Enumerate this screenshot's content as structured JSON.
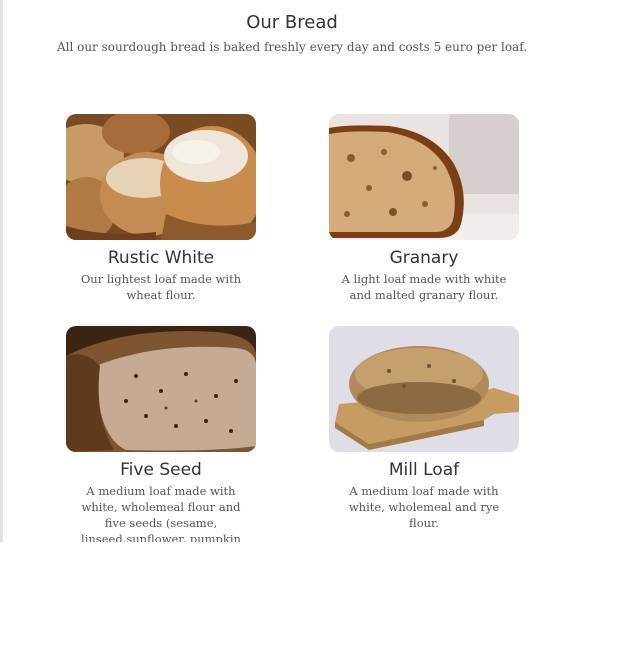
{
  "header": {
    "title": "Our Bread",
    "subtitle": "All our sourdough bread is baked freshly every day and costs 5 euro per loaf."
  },
  "breads": [
    {
      "name": "Rustic White",
      "description": "Our lightest loaf made with wheat flour.",
      "image": "rustic-white-bread-photo"
    },
    {
      "name": "Granary",
      "description": "A light loaf made with white and malted granary flour.",
      "image": "granary-bread-photo"
    },
    {
      "name": "Five Seed",
      "description": "A medium loaf made with white, wholemeal flour and five seeds (sesame, linseed,sunflower, pumpkin and poppy)",
      "image": "five-seed-bread-photo"
    },
    {
      "name": "Mill Loaf",
      "description": "A medium loaf made with white, wholemeal and rye flour.",
      "image": "mill-loaf-bread-photo"
    }
  ],
  "colors": {
    "text": "#333333",
    "muted": "#555555",
    "crust": "#8a5425",
    "crumb": "#d9bf95",
    "background": "#ffffff"
  }
}
